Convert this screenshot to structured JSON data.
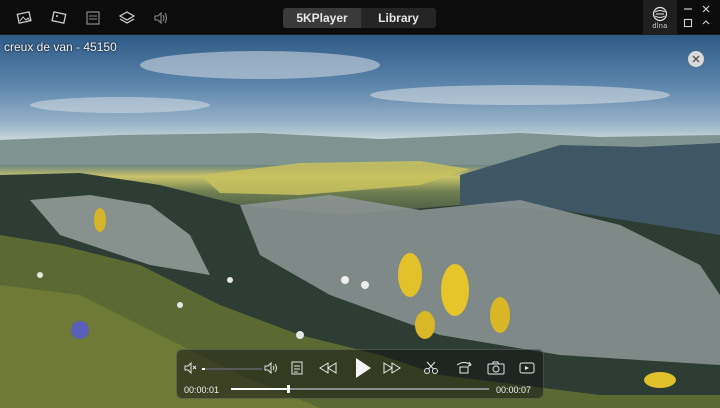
{
  "app": {
    "tabs": [
      {
        "label": "5KPlayer",
        "active": true
      },
      {
        "label": "Library",
        "active": false
      }
    ],
    "dlna_label": "dlna"
  },
  "toolbar_icons": [
    "photo-icon",
    "picture-icon",
    "list-icon",
    "layers-icon",
    "airplay-audio-icon"
  ],
  "video": {
    "title": "creux de van - 45150"
  },
  "player": {
    "current_time": "00:00:01",
    "duration": "00:00:07",
    "progress": 0.22,
    "volume": 0.05
  },
  "colors": {
    "titlebar": "#0c0c0c",
    "tab_active": "#3a3a3a",
    "tab_inactive": "#252525",
    "control_text": "#f0f0f0"
  }
}
